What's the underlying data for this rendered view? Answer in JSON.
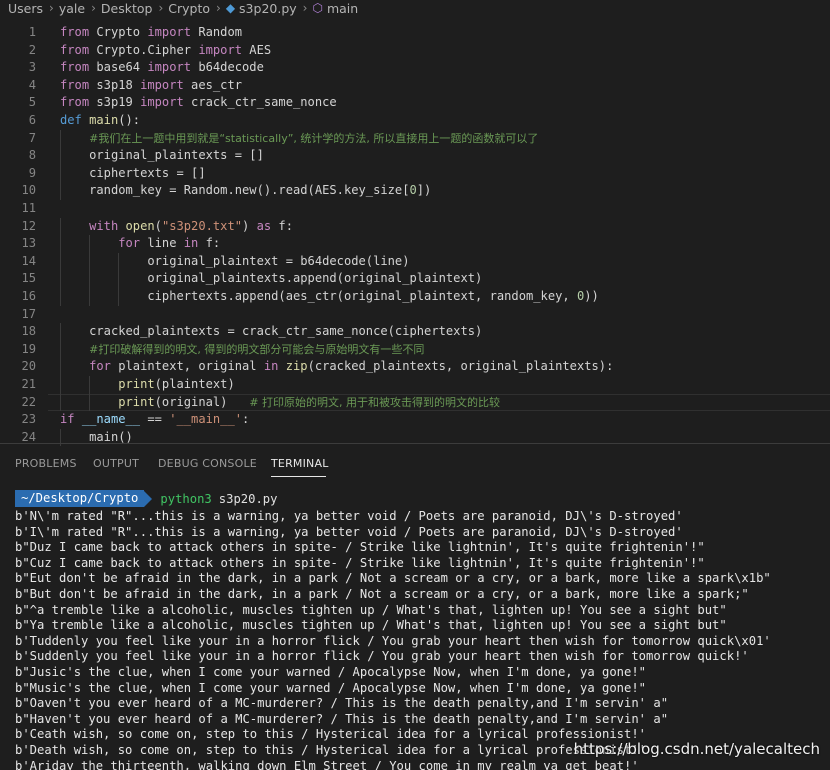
{
  "breadcrumb": {
    "items": [
      "Users",
      "yale",
      "Desktop",
      "Crypto",
      "s3p20.py",
      "main"
    ],
    "file_icon": "python-file-icon",
    "symbol_icon": "function-symbol-icon"
  },
  "editor": {
    "lines": [
      {
        "n": "1",
        "tokens": [
          [
            "kw",
            "from"
          ],
          [
            "plain",
            " Crypto "
          ],
          [
            "kw",
            "import"
          ],
          [
            "plain",
            " Random"
          ]
        ]
      },
      {
        "n": "2",
        "tokens": [
          [
            "kw",
            "from"
          ],
          [
            "plain",
            " Crypto.Cipher "
          ],
          [
            "kw",
            "import"
          ],
          [
            "plain",
            " AES"
          ]
        ]
      },
      {
        "n": "3",
        "tokens": [
          [
            "kw",
            "from"
          ],
          [
            "plain",
            " base64 "
          ],
          [
            "kw",
            "import"
          ],
          [
            "plain",
            " b64decode"
          ]
        ]
      },
      {
        "n": "4",
        "tokens": [
          [
            "kw",
            "from"
          ],
          [
            "plain",
            " s3p18 "
          ],
          [
            "kw",
            "import"
          ],
          [
            "plain",
            " aes_ctr"
          ]
        ]
      },
      {
        "n": "5",
        "tokens": [
          [
            "kw",
            "from"
          ],
          [
            "plain",
            " s3p19 "
          ],
          [
            "kw",
            "import"
          ],
          [
            "plain",
            " crack_ctr_same_nonce"
          ]
        ]
      },
      {
        "n": "6",
        "tokens": [
          [
            "kw2",
            "def"
          ],
          [
            "plain",
            " "
          ],
          [
            "fn",
            "main"
          ],
          [
            "plain",
            "():"
          ]
        ]
      },
      {
        "n": "7",
        "tokens": [
          [
            "plain",
            "    "
          ],
          [
            "cmt",
            "#我们在上一题中用到就是“statistically”, 统计学的方法, 所以直接用上一题的函数就可以了"
          ]
        ]
      },
      {
        "n": "8",
        "tokens": [
          [
            "plain",
            "    original_plaintexts = []"
          ]
        ]
      },
      {
        "n": "9",
        "tokens": [
          [
            "plain",
            "    ciphertexts = []"
          ]
        ]
      },
      {
        "n": "10",
        "tokens": [
          [
            "plain",
            "    random_key = Random.new().read(AES.key_size["
          ],
          [
            "num",
            "0"
          ],
          [
            "plain",
            "])"
          ]
        ]
      },
      {
        "n": "11",
        "tokens": []
      },
      {
        "n": "12",
        "tokens": [
          [
            "plain",
            "    "
          ],
          [
            "kw",
            "with"
          ],
          [
            "plain",
            " "
          ],
          [
            "fn",
            "open"
          ],
          [
            "plain",
            "("
          ],
          [
            "str",
            "\"s3p20.txt\""
          ],
          [
            "plain",
            ") "
          ],
          [
            "kw",
            "as"
          ],
          [
            "plain",
            " f:"
          ]
        ]
      },
      {
        "n": "13",
        "tokens": [
          [
            "plain",
            "        "
          ],
          [
            "kw",
            "for"
          ],
          [
            "plain",
            " line "
          ],
          [
            "kw",
            "in"
          ],
          [
            "plain",
            " f:"
          ]
        ]
      },
      {
        "n": "14",
        "tokens": [
          [
            "plain",
            "            original_plaintext = b64decode(line)"
          ]
        ]
      },
      {
        "n": "15",
        "tokens": [
          [
            "plain",
            "            original_plaintexts.append(original_plaintext)"
          ]
        ]
      },
      {
        "n": "16",
        "tokens": [
          [
            "plain",
            "            ciphertexts.append(aes_ctr(original_plaintext, random_key, "
          ],
          [
            "num",
            "0"
          ],
          [
            "plain",
            "))"
          ]
        ]
      },
      {
        "n": "17",
        "tokens": []
      },
      {
        "n": "18",
        "tokens": [
          [
            "plain",
            "    cracked_plaintexts = crack_ctr_same_nonce(ciphertexts)"
          ]
        ]
      },
      {
        "n": "19",
        "tokens": [
          [
            "plain",
            "    "
          ],
          [
            "cmt",
            "#打印破解得到的明文, 得到的明文部分可能会与原始明文有一些不同"
          ]
        ]
      },
      {
        "n": "20",
        "tokens": [
          [
            "plain",
            "    "
          ],
          [
            "kw",
            "for"
          ],
          [
            "plain",
            " plaintext, original "
          ],
          [
            "kw",
            "in"
          ],
          [
            "plain",
            " "
          ],
          [
            "fn",
            "zip"
          ],
          [
            "plain",
            "(cracked_plaintexts, original_plaintexts):"
          ]
        ]
      },
      {
        "n": "21",
        "tokens": [
          [
            "plain",
            "        "
          ],
          [
            "fn",
            "print"
          ],
          [
            "plain",
            "(plaintext)"
          ]
        ]
      },
      {
        "n": "22",
        "tokens": [
          [
            "plain",
            "        "
          ],
          [
            "fn",
            "print"
          ],
          [
            "plain",
            "(original)   "
          ],
          [
            "cmt",
            "# 打印原始的明文, 用于和被攻击得到的明文的比较"
          ]
        ]
      },
      {
        "n": "23",
        "tokens": [
          [
            "kw",
            "if"
          ],
          [
            "plain",
            " "
          ],
          [
            "var",
            "__name__"
          ],
          [
            "plain",
            " == "
          ],
          [
            "str",
            "'__main__'"
          ],
          [
            "plain",
            ":"
          ]
        ]
      },
      {
        "n": "24",
        "tokens": [
          [
            "plain",
            "    main()"
          ]
        ]
      }
    ]
  },
  "panel": {
    "tabs": [
      {
        "label": "PROBLEMS",
        "active": false
      },
      {
        "label": "OUTPUT",
        "active": false
      },
      {
        "label": "DEBUG CONSOLE",
        "active": false
      },
      {
        "label": "TERMINAL",
        "active": true
      }
    ]
  },
  "terminal": {
    "prompt_cwd": "~/Desktop/Crypto",
    "command": "python3",
    "argument": "s3p20.py",
    "output": [
      "b'N\\'m rated \"R\"...this is a warning, ya better void / Poets are paranoid, DJ\\'s D-stroyed'",
      "b'I\\'m rated \"R\"...this is a warning, ya better void / Poets are paranoid, DJ\\'s D-stroyed'",
      "b\"Duz I came back to attack others in spite- / Strike like lightnin', It's quite frightenin'!\"",
      "b\"Cuz I came back to attack others in spite- / Strike like lightnin', It's quite frightenin'!\"",
      "b\"Eut don't be afraid in the dark, in a park / Not a scream or a cry, or a bark, more like a spark\\x1b\"",
      "b\"But don't be afraid in the dark, in a park / Not a scream or a cry, or a bark, more like a spark;\"",
      "b\"^a tremble like a alcoholic, muscles tighten up / What's that, lighten up! You see a sight but\"",
      "b\"Ya tremble like a alcoholic, muscles tighten up / What's that, lighten up! You see a sight but\"",
      "b'Tuddenly you feel like your in a horror flick / You grab your heart then wish for tomorrow quick\\x01'",
      "b'Suddenly you feel like your in a horror flick / You grab your heart then wish for tomorrow quick!'",
      "b\"Jusic's the clue, when I come your warned / Apocalypse Now, when I'm done, ya gone!\"",
      "b\"Music's the clue, when I come your warned / Apocalypse Now, when I'm done, ya gone!\"",
      "b\"Oaven't you ever heard of a MC-murderer? / This is the death penalty,and I'm servin' a\"",
      "b\"Haven't you ever heard of a MC-murderer? / This is the death penalty,and I'm servin' a\"",
      "b'Ceath wish, so come on, step to this / Hysterical idea for a lyrical professionist!'",
      "b'Death wish, so come on, step to this / Hysterical idea for a lyrical professionist!'",
      "b'Ariday the thirteenth, walking down Elm Street / You come in my realm ya get beat!'"
    ]
  },
  "watermark": "https://blog.csdn.net/yalecaltech"
}
